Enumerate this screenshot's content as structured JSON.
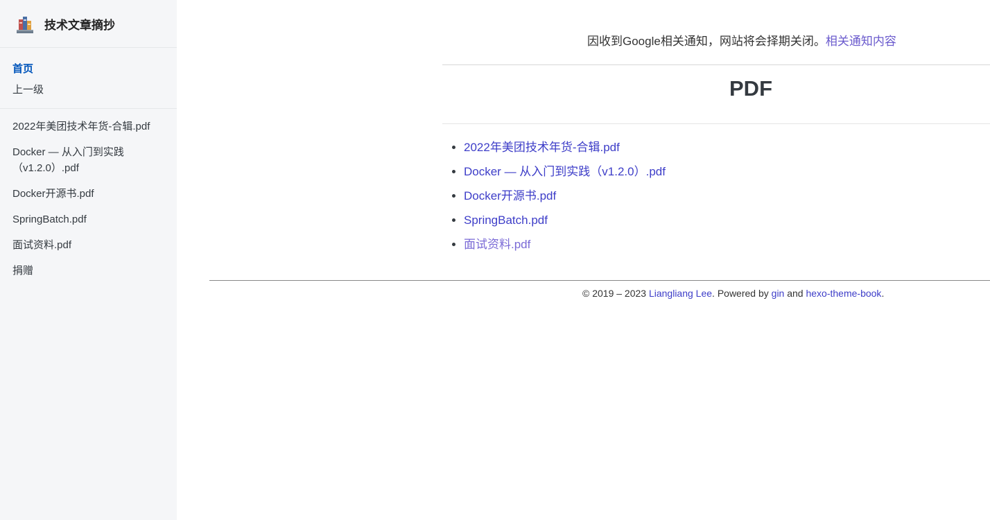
{
  "brand": {
    "logo_icon": "books-icon",
    "title": "技术文章摘抄"
  },
  "nav": {
    "home": "首页",
    "up": "上一级"
  },
  "sidebar_files": [
    "2022年美团技术年货-合辑.pdf",
    "Docker — 从入门到实践（v1.2.0）.pdf",
    "Docker开源书.pdf",
    "SpringBatch.pdf",
    "面试资料.pdf",
    "捐赠"
  ],
  "notice": {
    "text": "因收到Google相关通知，网站将会择期关闭。",
    "link": "相关通知内容"
  },
  "page": {
    "title": "PDF",
    "files": [
      "2022年美团技术年货-合辑.pdf",
      "Docker — 从入门到实践（v1.2.0）.pdf",
      "Docker开源书.pdf",
      "SpringBatch.pdf",
      "面试资料.pdf"
    ]
  },
  "footer": {
    "copyright": "© 2019 – 2023 ",
    "author": "Liangliang Lee",
    "powered": ". Powered by ",
    "engine": "gin",
    "and": " and ",
    "theme": "hexo-theme-book",
    "end": "."
  },
  "colors": {
    "sidebar_bg": "#f5f6f8",
    "active_nav": "#0055bb",
    "link": "#3d3dc8",
    "visited_link": "#7a6ad6"
  }
}
